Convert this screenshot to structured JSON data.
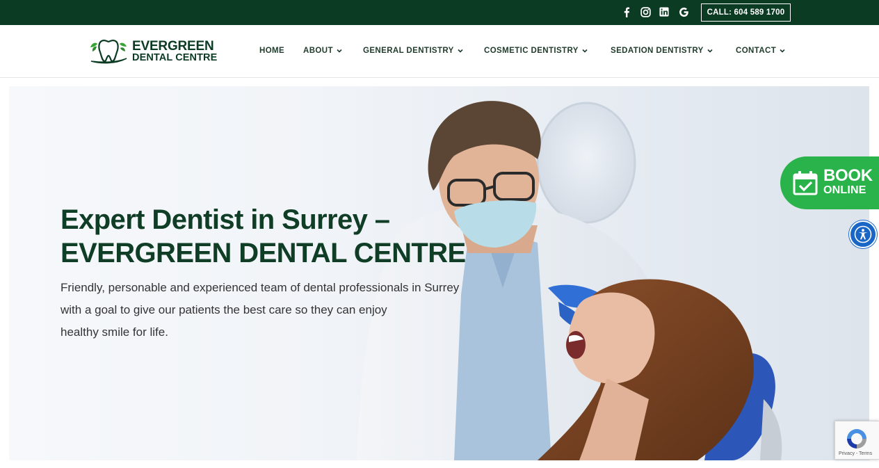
{
  "topbar": {
    "social_icons": [
      "facebook-icon",
      "instagram-icon",
      "linkedin-icon",
      "google-icon"
    ],
    "call_label": "CALL: 604 589 1700"
  },
  "logo": {
    "line1": "EVERGREEN",
    "line2": "DENTAL CENTRE"
  },
  "nav": {
    "home": "HOME",
    "about": "ABOUT",
    "general": "GENERAL DENTISTRY",
    "cosmetic": "COSMETIC DENTISTRY",
    "sedation": "SEDATION DENTISTRY",
    "contact": "CONTACT"
  },
  "hero": {
    "title_line1": "Expert Dentist in Surrey –",
    "title_line2": "EVERGREEN DENTAL CENTRE",
    "sub_line1": "Friendly, personable and experienced team of dental professionals in Surrey",
    "sub_line2": "with a goal to give our patients the best care so they can enjoy",
    "sub_line3": "healthy smile for life."
  },
  "book": {
    "line1": "BOOK",
    "line2": "ONLINE"
  },
  "recaptcha": {
    "links": "Privacy - Terms"
  },
  "colors": {
    "brand_dark_green": "#0c3b24",
    "book_green": "#29b34a",
    "accessibility_blue": "#1a66c7"
  }
}
